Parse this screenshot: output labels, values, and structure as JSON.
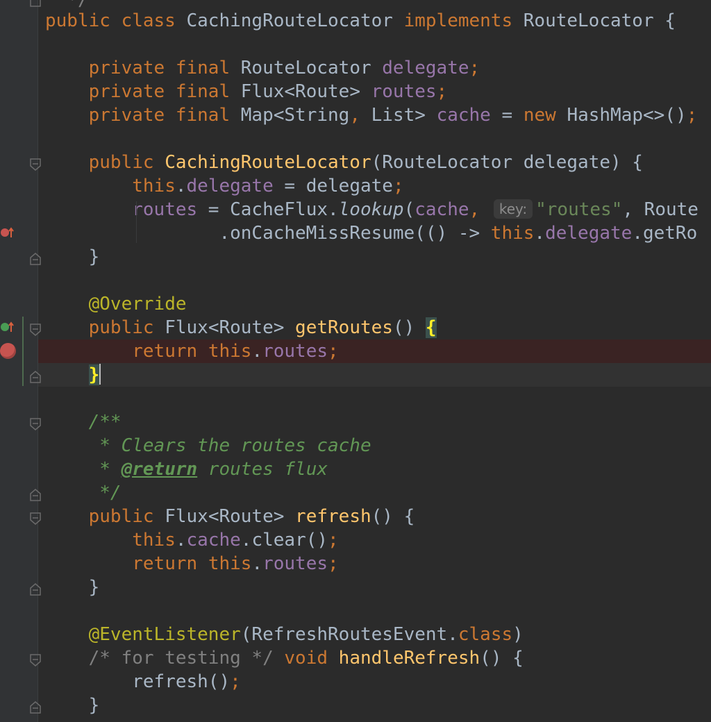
{
  "editor": {
    "language": "java",
    "code": {
      "l0": "*/",
      "l1": {
        "a": "public class ",
        "b": "CachingRouteLocator ",
        "c": "implements ",
        "d": "RouteLocator {"
      },
      "l3": {
        "a": "private final ",
        "b": "RouteLocator ",
        "c": "delegate",
        "d": ";"
      },
      "l4": {
        "a": "private final ",
        "b": "Flux<Route> ",
        "c": "routes",
        "d": ";"
      },
      "l5": {
        "a": "private final ",
        "b": "Map<String",
        "c": ", ",
        "d": "List> ",
        "e": "cache",
        "f": " = ",
        "g": "new ",
        "h": "HashMap<>()",
        "i": ";"
      },
      "l7": {
        "a": "public ",
        "b": "CachingRouteLocator",
        "c": "(RouteLocator delegate) {"
      },
      "l8": {
        "a": "this",
        "b": ".",
        "c": "delegate",
        "d": " = delegate",
        "e": ";"
      },
      "l9": {
        "a": "routes",
        "b": " = CacheFlux.",
        "c": "lookup",
        "d": "(",
        "e": "cache",
        "f": ", ",
        "hint": "key:",
        "g": "\"routes\"",
        "h": ", Route"
      },
      "l10": {
        "a": ".onCacheMissResume(() -> ",
        "b": "this",
        "c": ".",
        "d": "delegate",
        "e": ".getRo"
      },
      "l11": "}",
      "l13": "@Override",
      "l14": {
        "a": "public ",
        "b": "Flux<Route> ",
        "c": "getRoutes",
        "d": "() ",
        "e": "{"
      },
      "l15": {
        "a": "return ",
        "b": "this",
        "c": ".",
        "d": "routes",
        "e": ";"
      },
      "l16": "}",
      "l18": "/**",
      "l19": " * Clears the routes cache",
      "l20": {
        "a": " * ",
        "b": "@return",
        "c": " routes flux"
      },
      "l21": " */",
      "l22": {
        "a": "public ",
        "b": "Flux<Route> ",
        "c": "refresh",
        "d": "() {"
      },
      "l23": {
        "a": "this",
        "b": ".",
        "c": "cache",
        "d": ".clear()",
        "e": ";"
      },
      "l24": {
        "a": "return ",
        "b": "this",
        "c": ".",
        "d": "routes",
        "e": ";"
      },
      "l25": "}",
      "l27": {
        "a": "@EventListener",
        "b": "(RefreshRoutesEvent.",
        "c": "class",
        "d": ")"
      },
      "l28": {
        "a": "/* for testing */ ",
        "b": "void ",
        "c": "handleRefresh",
        "d": "() {"
      },
      "l29": {
        "a": "refresh()",
        "b": ";"
      },
      "l30": "}"
    }
  },
  "colors": {
    "background": "#2b2b2b",
    "keyword": "#cc7832",
    "field": "#9876aa",
    "method": "#ffc66d",
    "string": "#6a8759",
    "annotation": "#bbb529",
    "doc_comment": "#629755",
    "breakpoint": "#c75450"
  },
  "icons": {
    "breakpoint": "breakpoint-icon",
    "override": "override-icon",
    "fold": "fold-icon"
  }
}
